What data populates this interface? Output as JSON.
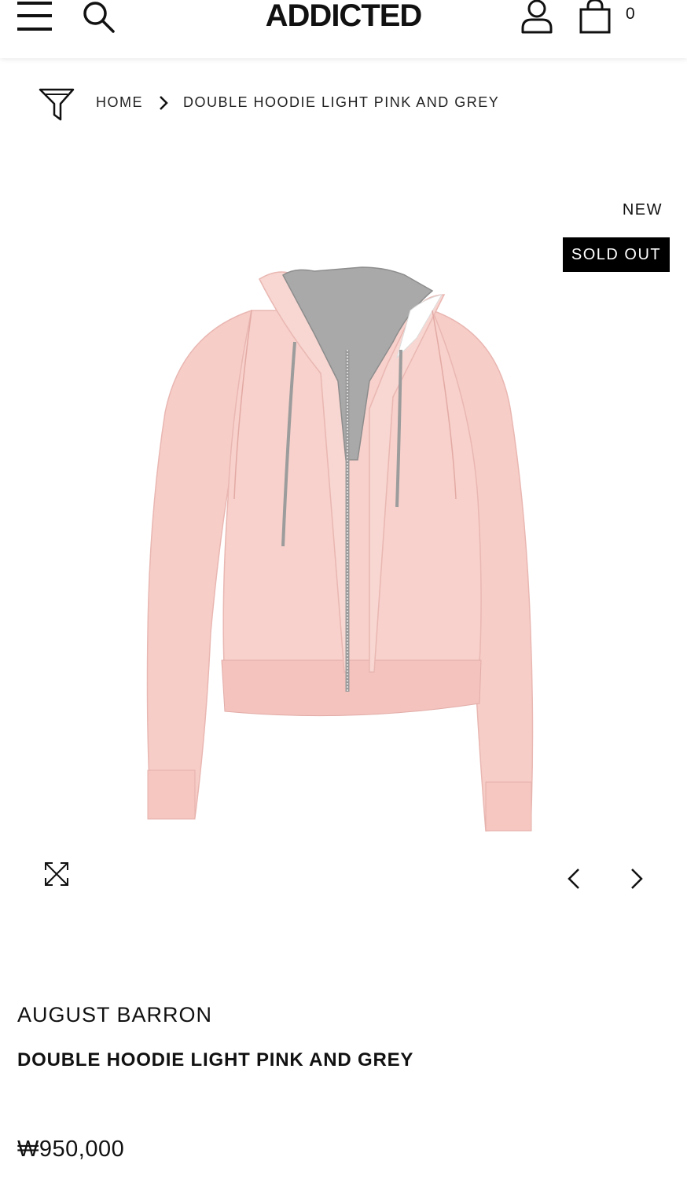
{
  "header": {
    "logo": "ADDICTED",
    "menu_icon": "hamburger-menu-icon",
    "search_icon": "search-icon",
    "account_icon": "user-icon",
    "cart_icon": "shopping-bag-icon",
    "cart_count": "0"
  },
  "breadcrumb": {
    "filter_icon": "filter-funnel-icon",
    "home": "HOME",
    "separator_icon": "chevron-right-icon",
    "current": "DOUBLE HOODIE LIGHT PINK AND GREY"
  },
  "badges": {
    "new": "NEW",
    "sold_out": "SOLD OUT"
  },
  "gallery": {
    "image_subject": "light pink zip hoodie with grey inner hood",
    "expand_icon": "expand-arrows-icon",
    "prev_icon": "chevron-left-icon",
    "next_icon": "chevron-right-icon"
  },
  "product": {
    "brand": "AUGUST BARRON",
    "name": "DOUBLE HOODIE LIGHT PINK AND GREY",
    "price": "₩950,000"
  },
  "colors": {
    "hoodie_pink": "#f7cdc8",
    "inner_grey": "#a9a9a9",
    "badge_bg": "#000000",
    "text": "#111111"
  }
}
